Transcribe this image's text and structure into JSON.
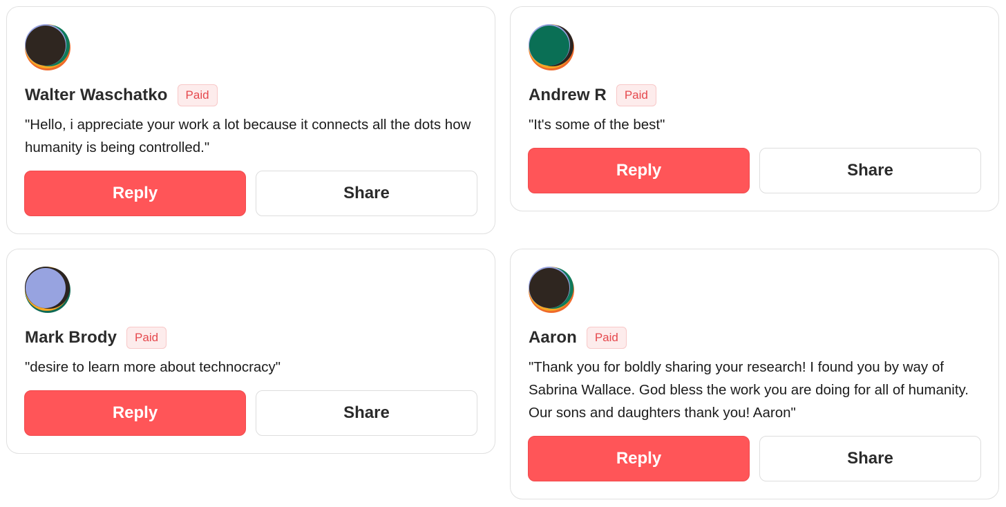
{
  "comments": [
    {
      "name": "Walter Waschatko",
      "badge": "Paid",
      "message": "\"Hello, i appreciate your work a lot because it connects all the dots how humanity is being controlled.\"",
      "reply_label": "Reply",
      "share_label": "Share",
      "avatar_colors": {
        "main": "#2f2620",
        "ring": "#0f7a5a",
        "accent": "#f5a623",
        "edge": "#ef6a2a"
      }
    },
    {
      "name": "Andrew R",
      "badge": "Paid",
      "message": "\"It's some of the best\"",
      "reply_label": "Reply",
      "share_label": "Share",
      "avatar_colors": {
        "main": "#0a6f55",
        "ring": "#2b2420",
        "accent": "#f5a623",
        "edge": "#ef6a2a"
      }
    },
    {
      "name": "Mark Brody",
      "badge": "Paid",
      "message": "\"desire to learn more about technocracy\"",
      "reply_label": "Reply",
      "share_label": "Share",
      "avatar_colors": {
        "main": "#97a3e0",
        "ring": "#2b2420",
        "accent": "#f5a623",
        "edge": "#0f6a55"
      }
    },
    {
      "name": "Aaron",
      "badge": "Paid",
      "message": "\"Thank you for boldly sharing your research! I found you by way of Sabrina Wallace. God bless the work you are doing for all of humanity. Our sons and daughters thank you! Aaron\"",
      "reply_label": "Reply",
      "share_label": "Share",
      "avatar_colors": {
        "main": "#2f2620",
        "ring": "#0f7a5a",
        "accent": "#f5a623",
        "edge": "#ef6a2a"
      }
    }
  ],
  "colors": {
    "reply_bg": "#ff5558",
    "badge_text": "#e5484d",
    "badge_bg": "#fdecec"
  }
}
